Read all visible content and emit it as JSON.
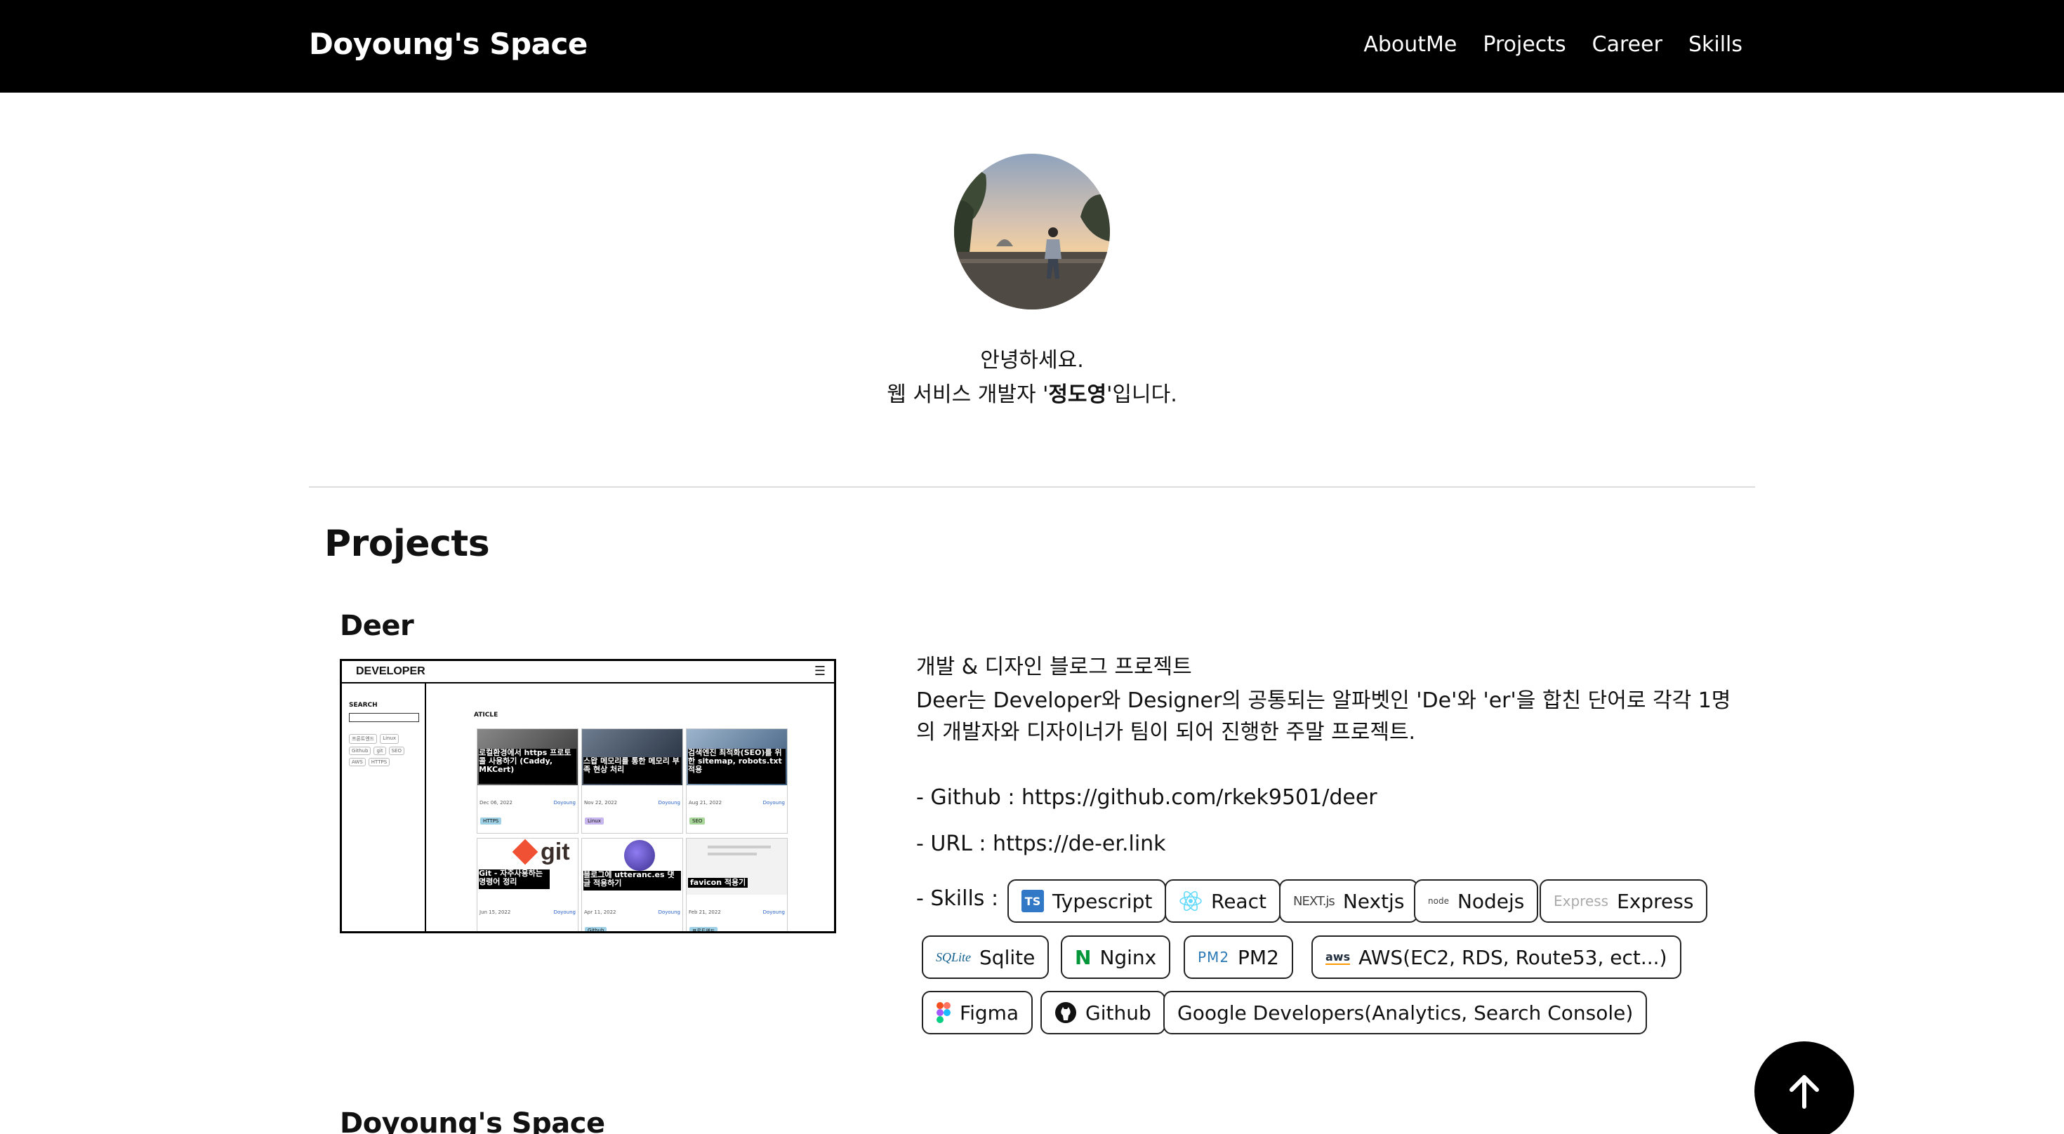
{
  "header": {
    "brand": "Doyoung's Space",
    "nav": [
      "AboutMe",
      "Projects",
      "Career",
      "Skills"
    ]
  },
  "intro": {
    "line1": "안녕하세요.",
    "line2_prefix": "웹 서비스 개발자 '",
    "line2_name": "정도영",
    "line2_suffix": "'입니다."
  },
  "projects": {
    "section_title": "Projects",
    "items": [
      {
        "title": "Deer",
        "summary": "개발 & 디자인 블로그 프로젝트",
        "description_line1": "Deer는 Developer와 Designer의 공통되는 알파벳인 'De'와 'er'을 합친 단어로 각각 1명",
        "description_line2": "의 개발자와 디자이너가 팀이 되어 진행한 주말 프로젝트.",
        "github": "- Github : https://github.com/rkek9501/deer",
        "url": "- URL : https://de-er.link",
        "skills_label": "- Skills :",
        "skills": [
          {
            "label": "Typescript",
            "icon": "typescript-icon",
            "icon_text": "TS"
          },
          {
            "label": "React",
            "icon": "react-icon",
            "icon_text": ""
          },
          {
            "label": "Nextjs",
            "icon": "nextjs-icon",
            "icon_text": "NEXT.js"
          },
          {
            "label": "Nodejs",
            "icon": "nodejs-icon",
            "icon_text": "node"
          },
          {
            "label": "Express",
            "icon": "express-icon",
            "icon_text": "Express"
          },
          {
            "label": "Sqlite",
            "icon": "sqlite-icon",
            "icon_text": "SQLite"
          },
          {
            "label": "Nginx",
            "icon": "nginx-icon",
            "icon_text": "N"
          },
          {
            "label": "PM2",
            "icon": "pm2-icon",
            "icon_text": "PM2"
          },
          {
            "label": "AWS(EC2, RDS, Route53, ect...)",
            "icon": "aws-icon",
            "icon_text": "aws"
          },
          {
            "label": "Figma",
            "icon": "figma-icon",
            "icon_text": ""
          },
          {
            "label": "Github",
            "icon": "github-icon",
            "icon_text": ""
          },
          {
            "label": "Google Developers(Analytics, Search Console)",
            "icon": "",
            "icon_text": ""
          }
        ],
        "thumbnail": {
          "logo": "DEVELOPER",
          "search_label": "SEARCH",
          "tags": [
            "프론트엔드",
            "Linux",
            "Github",
            "git",
            "SEO",
            "AWS",
            "HTTPS"
          ],
          "article_label": "ATICLE",
          "cards": [
            {
              "title": "로컬환경에서 https 프로토콜 사용하기 (Caddy, MKCert)",
              "date": "Dec 06, 2022",
              "author": "Doyoung",
              "tag": "HTTPS"
            },
            {
              "title": "스왑 메모리를 통한 메모리 부족 현상 처리",
              "date": "Nov 22, 2022",
              "author": "Doyoung",
              "tag": "Linux"
            },
            {
              "title": "검색엔진 최적화(SEO)를 위한 sitemap, robots.txt 적용",
              "date": "Aug 21, 2022",
              "author": "Doyoung",
              "tag": "SEO"
            },
            {
              "title": "Git - 자주사용하는 명령어 정리",
              "date": "Jun 15, 2022",
              "author": "Doyoung",
              "tag": "git"
            },
            {
              "title": "블로그에 utteranc.es 댓글 적용하기",
              "date": "Apr 11, 2022",
              "author": "Doyoung",
              "tag": "Github"
            },
            {
              "title": "favicon 적용기",
              "date": "Feb 21, 2022",
              "author": "Doyoung",
              "tag": "프론트엔드"
            }
          ]
        }
      },
      {
        "title": "Doyoung's Space"
      }
    ]
  },
  "colors": {
    "header_bg": "#000000",
    "accent": "#000000",
    "divider": "#dddddd"
  }
}
